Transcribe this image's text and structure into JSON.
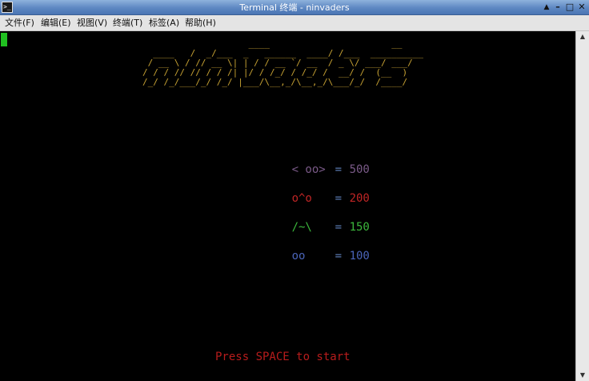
{
  "window": {
    "title": "Terminal 终端 - ninvaders",
    "controls": {
      "shade": "▲",
      "minimize": "–",
      "maximize": "□",
      "close": "✕"
    }
  },
  "menu": {
    "file": "文件(F)",
    "edit": "编辑(E)",
    "view": "视图(V)",
    "terminal": "终端(T)",
    "tabs": "标签(A)",
    "help": "帮助(H)"
  },
  "game": {
    "logo": "                    ____                       __\n  ____   /  _/___  _   ______  ____/ /___  __________\n / __ \\ / // __ \\| | / / __ `/ __  / _ \\/ ___/ ___/\n/ / / // // / / /| |/ / /_/ / /_/ /  __/ /  (__  )\n/_/ /_/___/_/ /_/ |___/\\__,_/\\__,_/\\___/_/  /____/",
    "score_table": [
      {
        "alien": "< oo>",
        "equals": "=",
        "points": "500",
        "color": "#7a5a88"
      },
      {
        "alien": "o^o",
        "equals": "=",
        "points": "200",
        "color": "#c02525"
      },
      {
        "alien": "/~\\",
        "equals": "=",
        "points": "150",
        "color": "#3cb83c"
      },
      {
        "alien": "oo",
        "equals": "=",
        "points": "100",
        "color": "#4a64b8"
      }
    ],
    "equals_color": "#5a7ab0",
    "prompt": "Press SPACE to start",
    "logo_color": "#c7a233",
    "cursor_color": "#20c020"
  },
  "scrollbar": {
    "up": "▲",
    "down": "▼"
  }
}
